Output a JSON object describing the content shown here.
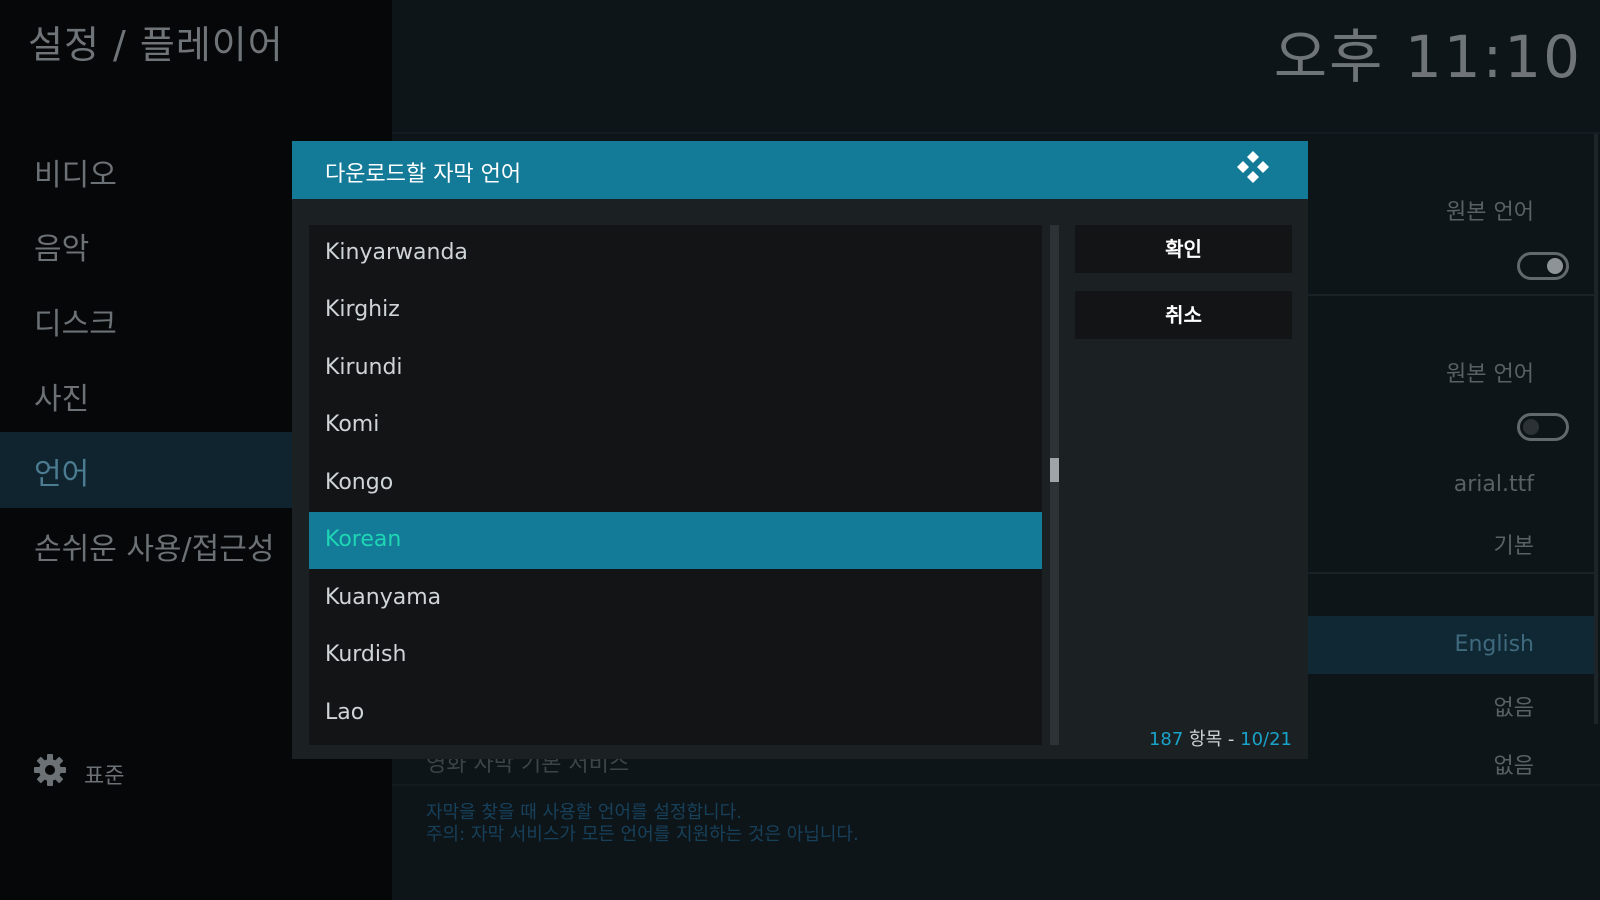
{
  "header": {
    "breadcrumb": "설정 / 플레이어",
    "clock": "오후 11:10"
  },
  "sidebar": {
    "items": [
      {
        "label": "비디오"
      },
      {
        "label": "음악"
      },
      {
        "label": "디스크"
      },
      {
        "label": "사진"
      },
      {
        "label": "언어",
        "selected": true
      },
      {
        "label": "손쉬운 사용/접근성"
      }
    ],
    "footer": {
      "icon": "gear-icon",
      "label": "표준"
    }
  },
  "background_settings": {
    "values": [
      "원본 언어",
      "원본 언어",
      "arial.ttf",
      "기본",
      "English",
      "없음",
      "없음"
    ],
    "toggle_states": [
      true,
      false
    ],
    "row_label_partial": "영화 자막 기본 서비스",
    "description": [
      "자막을 찾을 때 사용할 언어를 설정합니다.",
      "주의: 자막 서비스가 모든 언어를 지원하는 것은 아닙니다."
    ]
  },
  "dialog": {
    "title": "다운로드할 자막 언어",
    "logo_icon": "kodi-logo-icon",
    "items": [
      {
        "label": "Kinyarwanda"
      },
      {
        "label": "Kirghiz"
      },
      {
        "label": "Kirundi"
      },
      {
        "label": "Komi"
      },
      {
        "label": "Kongo"
      },
      {
        "label": "Korean",
        "selected": true
      },
      {
        "label": "Kuanyama"
      },
      {
        "label": "Kurdish"
      },
      {
        "label": "Lao"
      }
    ],
    "ok_label": "확인",
    "cancel_label": "취소",
    "count": {
      "total": "187",
      "items_word": "항목",
      "separator": "-",
      "page": "10/21"
    },
    "scroll_position": 0.47
  },
  "colors": {
    "accent": "#137a98",
    "selected_text": "#1ed6b3",
    "count_number": "#1aa3c8",
    "dialog_bg": "#1b2023"
  }
}
